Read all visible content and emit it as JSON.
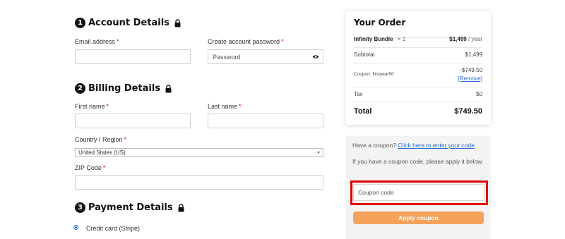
{
  "sections": {
    "account": {
      "number": "1",
      "title": "Account Details"
    },
    "billing": {
      "number": "2",
      "title": "Billing Details"
    },
    "payment": {
      "number": "3",
      "title": "Payment Details"
    }
  },
  "fields": {
    "email": {
      "label": "Email address",
      "required": "*",
      "value": ""
    },
    "password": {
      "label": "Create account password",
      "required": "*",
      "placeholder": "Password"
    },
    "first_name": {
      "label": "First name",
      "required": "*",
      "value": ""
    },
    "last_name": {
      "label": "Last name",
      "required": "*",
      "value": ""
    },
    "country": {
      "label": "Country / Region",
      "required": "*",
      "selected": "United States (US)"
    },
    "zip": {
      "label": "ZIP Code",
      "required": "*",
      "value": ""
    }
  },
  "payment": {
    "method_label": "Credit card (Stripe)",
    "selected": true
  },
  "order": {
    "title": "Your Order",
    "item_name": "Infinity Bundle",
    "item_qty": "× 1",
    "item_price": "$1,499",
    "item_period": "/ year",
    "subtotal_label": "Subtotal",
    "subtotal_value": "$1,499",
    "coupon_label": "Coupon: firstyear50",
    "coupon_value": "-$749.50",
    "coupon_remove": "[Remove]",
    "tax_label": "Tax",
    "tax_value": "$0",
    "total_label": "Total",
    "total_value": "$749.50"
  },
  "coupon": {
    "prompt": "Have a coupon?",
    "link": "Click here to enter your code",
    "instruction": "If you have a coupon code, please apply it below.",
    "placeholder": "Coupon code",
    "apply_label": "Apply coupon"
  },
  "colors": {
    "accent": "#f4a25c",
    "link": "#2a6ad9",
    "required": "#d0021b",
    "highlight": "#e00000"
  }
}
